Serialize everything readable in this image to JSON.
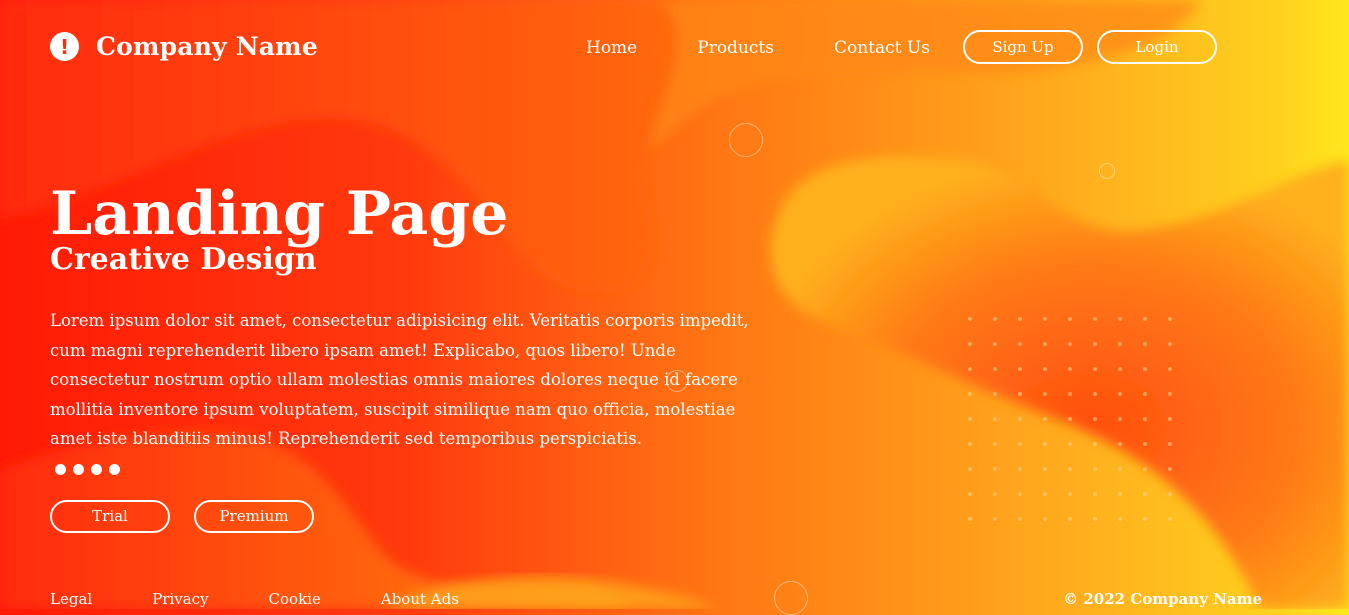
{
  "brand": {
    "icon": "exclamation-icon",
    "name": "Company Name"
  },
  "nav": {
    "items": [
      "Home",
      "Products",
      "Contact Us"
    ]
  },
  "auth": {
    "signup_label": "Sign Up",
    "login_label": "Login"
  },
  "hero": {
    "title": "Landing Page",
    "subtitle": "Creative Design",
    "text": "Lorem ipsum dolor sit amet, consectetur adipisicing elit. Veritatis corporis impedit, cum magni reprehenderit libero ipsam amet! Explicabo, quos libero! Unde consectetur nostrum optio ullam molestias omnis maiores dolores neque id facere mollitia inventore ipsum voluptatem, suscipit similique nam quo officia, molestiae amet iste blanditiis minus! Reprehenderit sed temporibus perspiciatis.",
    "buttons": {
      "trial_label": "Trial",
      "premium_label": "Premium"
    }
  },
  "footer": {
    "links": [
      "Legal",
      "Privacy",
      "Cookie",
      "About Ads"
    ],
    "copyright": "© 2022 Company Name"
  },
  "colors": {
    "gradient_left": "#ff1a05",
    "gradient_mid": "#ff7a14",
    "gradient_right": "#ffe81e",
    "text": "#ffffff"
  }
}
